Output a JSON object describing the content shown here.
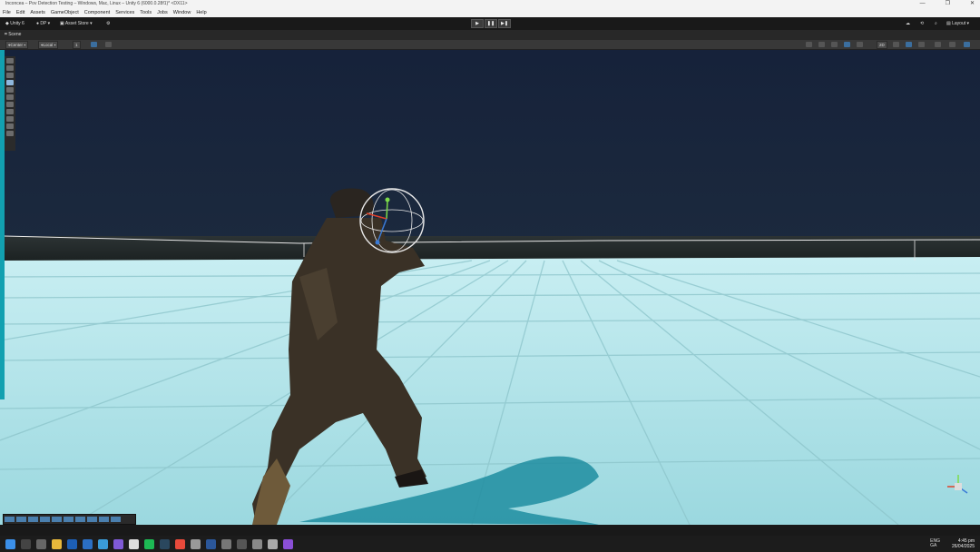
{
  "window": {
    "title": "Inconcea – Pov Detection Testing – Windows, Mac, Linux – Unity 6 (6000.0.28f1)* <DX11>",
    "controls": [
      "—",
      "❐",
      "✕"
    ]
  },
  "menu": [
    "File",
    "Edit",
    "Assets",
    "GameObject",
    "Component",
    "Services",
    "Tools",
    "Jobs",
    "Window",
    "Help"
  ],
  "toolbar": {
    "unity_label": "Unity 6",
    "account": "DP",
    "asset_store": "Asset Store",
    "layout": "Layout"
  },
  "scene_tab": {
    "label": "Scene"
  },
  "scene_toolbar": {
    "pivot": "Center",
    "space": "Local",
    "snap": "1",
    "mode_2d": "2D"
  },
  "clock": {
    "time": "4:45 pm",
    "date": "26/04/2025"
  },
  "tray": {
    "lang": "ENG",
    "region": "GA"
  },
  "colors": {
    "floor": "#a6dde4",
    "sky_top": "#16223a",
    "accent": "#12a0b0"
  }
}
